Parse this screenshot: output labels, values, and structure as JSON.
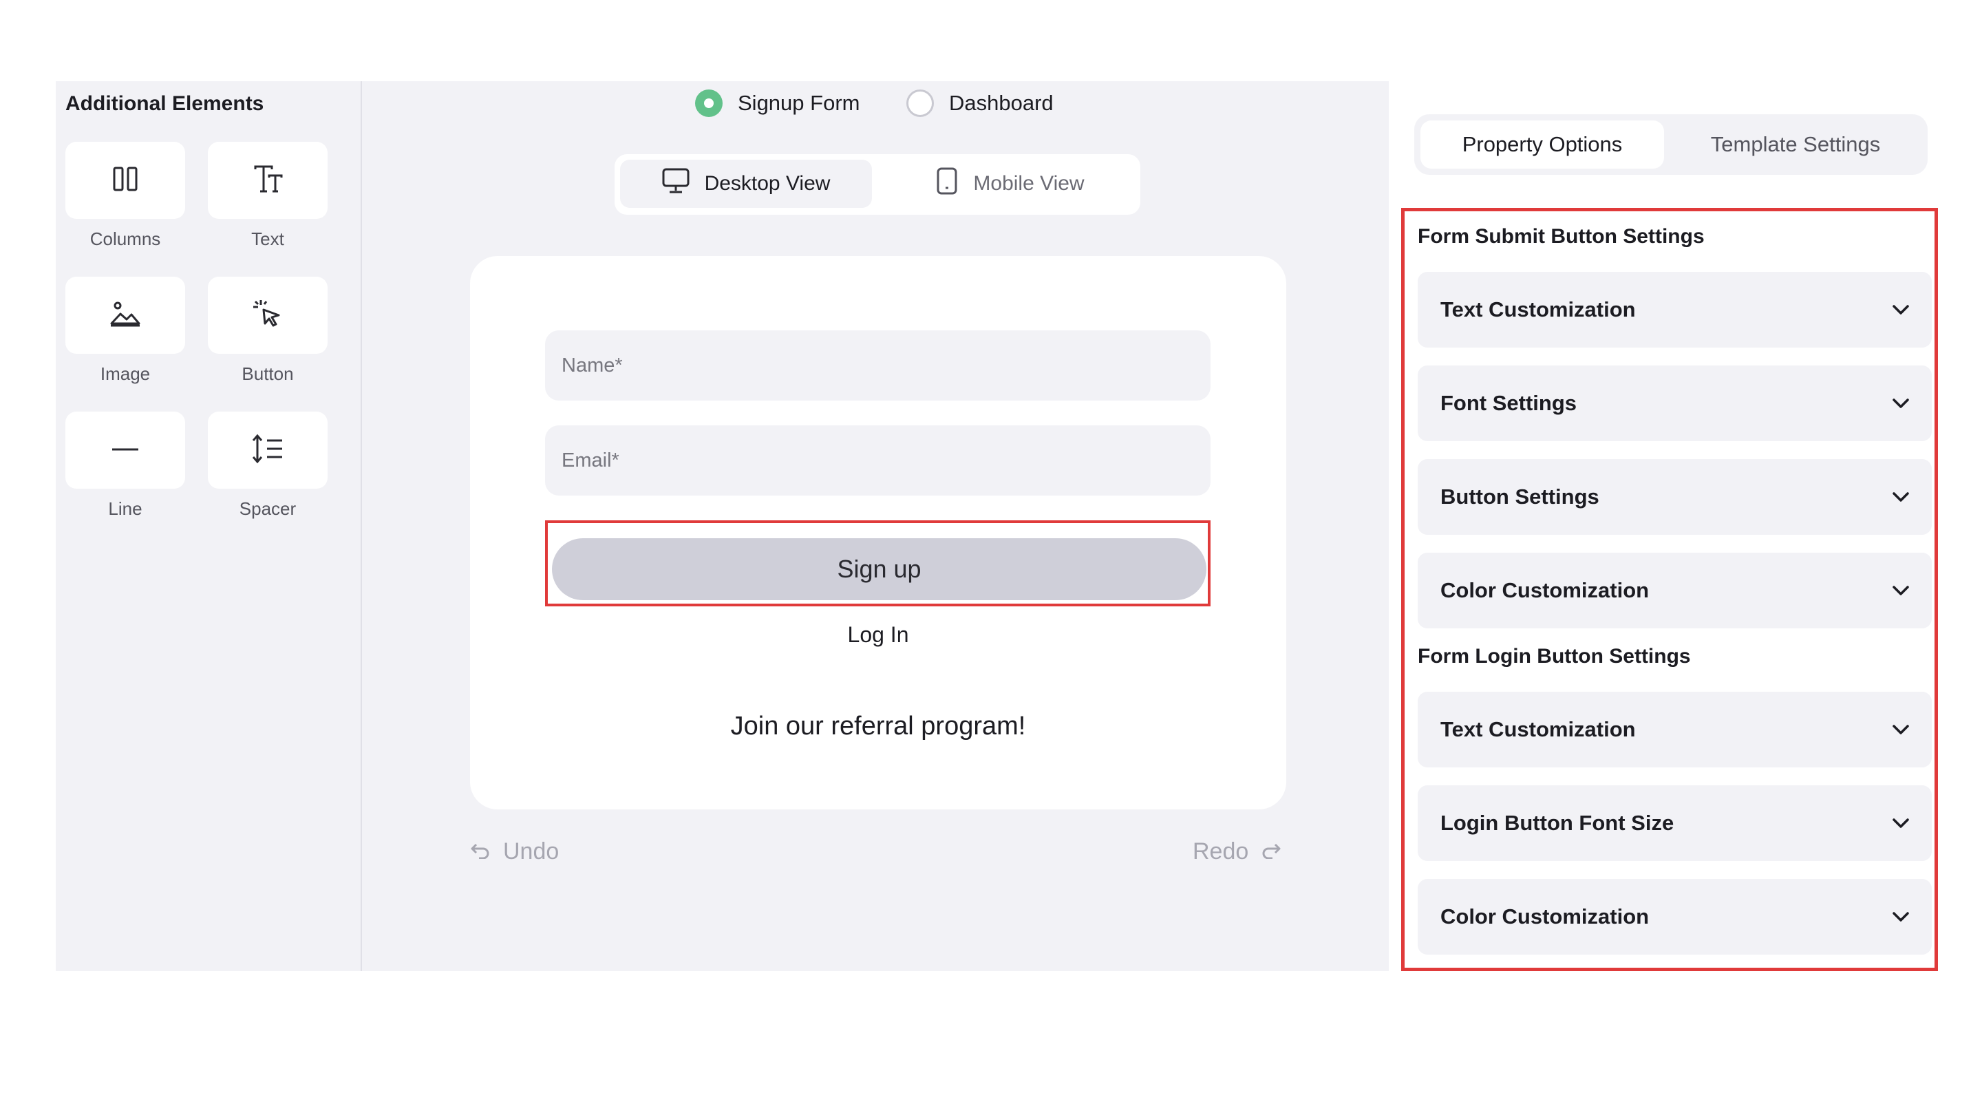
{
  "sidebar": {
    "title": "Additional Elements",
    "items": [
      {
        "label": "Columns",
        "icon": "columns-icon"
      },
      {
        "label": "Text",
        "icon": "text-icon"
      },
      {
        "label": "Image",
        "icon": "image-icon"
      },
      {
        "label": "Button",
        "icon": "cursor-click-icon"
      },
      {
        "label": "Line",
        "icon": "line-icon"
      },
      {
        "label": "Spacer",
        "icon": "spacer-icon"
      }
    ]
  },
  "canvas": {
    "radios": [
      {
        "label": "Signup Form",
        "selected": true
      },
      {
        "label": "Dashboard",
        "selected": false
      }
    ],
    "views": [
      {
        "label": "Desktop View",
        "icon": "monitor-icon",
        "active": true
      },
      {
        "label": "Mobile View",
        "icon": "mobile-icon",
        "active": false
      }
    ],
    "form": {
      "name_placeholder": "Name*",
      "email_placeholder": "Email*",
      "signup_label": "Sign up",
      "login_label": "Log In",
      "referral_text": "Join our referral program!"
    },
    "undo_label": "Undo",
    "redo_label": "Redo"
  },
  "right_panel": {
    "tabs": [
      {
        "label": "Property Options",
        "active": true
      },
      {
        "label": "Template Settings",
        "active": false
      }
    ],
    "sections": [
      {
        "title": "Form Submit Button Settings",
        "items": [
          "Text Customization",
          "Font Settings",
          "Button Settings",
          "Color Customization"
        ]
      },
      {
        "title": "Form Login Button Settings",
        "items": [
          "Text Customization",
          "Login Button Font Size",
          "Color Customization"
        ]
      }
    ]
  },
  "colors": {
    "accent_green": "#62c18a",
    "highlight_red": "#e03a3a",
    "panel_bg": "#f2f2f6",
    "button_gray": "#cfcfd9"
  }
}
